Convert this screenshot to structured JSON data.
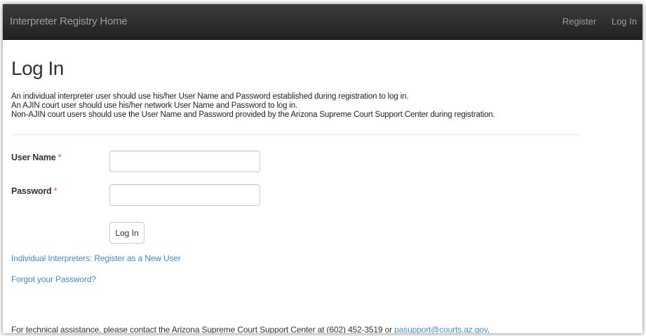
{
  "navbar": {
    "brand": "Interpreter Registry Home",
    "links": [
      "Register",
      "Log In"
    ]
  },
  "page": {
    "title": "Log In",
    "intro": [
      "An individual interpreter user should use his/her User Name and Password established during registration to log in.",
      "An AJIN court user should use his/her network User Name and Password to log in.",
      "Non-AJIN court users should use the User Name and Password provided by the Arizona Supreme Court Support Center during registration."
    ]
  },
  "form": {
    "username_label": "User Name",
    "password_label": "Password",
    "required_marker": "*",
    "username_value": "",
    "password_value": "",
    "submit_label": "Log In"
  },
  "links": {
    "register": "Individual Interpreters: Register as a New User",
    "forgot": "Forgot your Password?"
  },
  "footer": {
    "text": "For technical assistance, please contact the Arizona Supreme Court Support Center at (602) 452-3519 or ",
    "email": "pasupport@courts.az.gov",
    "end": "."
  },
  "colors": {
    "navbar": "#222222",
    "link": "#428bca",
    "required": "#d9534f"
  }
}
